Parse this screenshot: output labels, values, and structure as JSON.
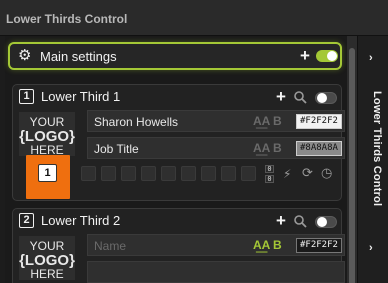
{
  "window": {
    "title": "Lower Thirds Control"
  },
  "main_settings": {
    "label": "Main settings",
    "add_label": "+",
    "toggle_on": true
  },
  "lower_thirds": [
    {
      "number": "1",
      "title": "Lower Third 1",
      "add_label": "+",
      "toggle_on": false,
      "logo": {
        "line1": "YOUR",
        "line2": "{LOGO}",
        "line3": "HERE"
      },
      "name": {
        "value": "Sharon Howells",
        "placeholder": "",
        "color": "#F2F2F2"
      },
      "job": {
        "value": "Job Title",
        "placeholder": "",
        "color": "#8A8A8A"
      },
      "selected_slot": "1",
      "stepper": {
        "top": "0",
        "bottom": "0"
      }
    },
    {
      "number": "2",
      "title": "Lower Third 2",
      "add_label": "+",
      "toggle_on": false,
      "logo": {
        "line1": "YOUR",
        "line2": "{LOGO}",
        "line3": "HERE"
      },
      "name": {
        "value": "",
        "placeholder": "Name",
        "color": "#F2F2F2"
      }
    }
  ],
  "sidebar": {
    "label": "Lower Thirds Control",
    "chevron_top": "›",
    "chevron_bottom": "›"
  },
  "colors": {
    "accent": "#a4c836",
    "highlight": "#ef6f0f"
  },
  "icons": [
    "gear-icon",
    "search-icon",
    "font-icon",
    "bold-icon",
    "lightning-icon",
    "sync-icon",
    "clock-icon",
    "chevron-right-icon"
  ]
}
